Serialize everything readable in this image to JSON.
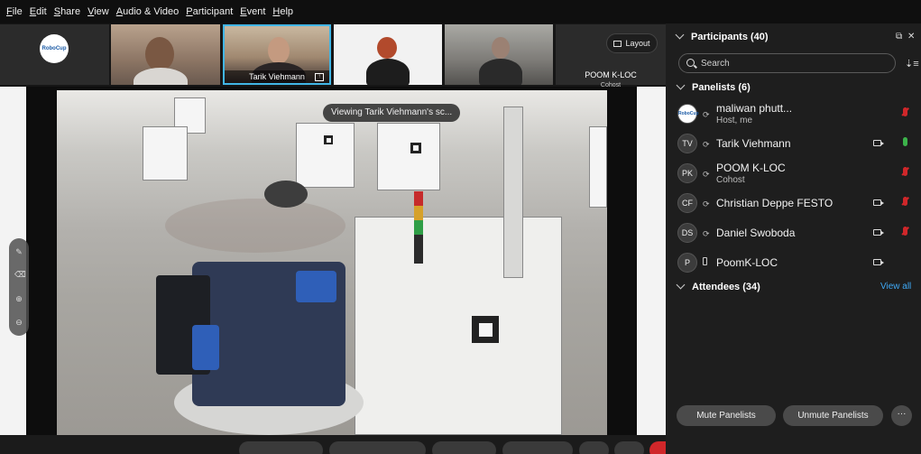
{
  "menu": {
    "items": [
      {
        "u": "F",
        "rest": "ile"
      },
      {
        "u": "E",
        "rest": "dit"
      },
      {
        "u": "S",
        "rest": "hare"
      },
      {
        "u": "V",
        "rest": "iew"
      },
      {
        "u": "A",
        "rest": "udio & Video"
      },
      {
        "u": "P",
        "rest": "articipant"
      },
      {
        "u": "E",
        "rest": "vent"
      },
      {
        "u": "H",
        "rest": "elp"
      }
    ]
  },
  "thumbnails": {
    "logo_text": "RoboCup",
    "active_name": "Tarik Viehmann",
    "poom_name": "POOM K-LOC",
    "poom_role": "Cohost",
    "layout_label": "Layout"
  },
  "stage": {
    "viewing_banner": "Viewing Tarik Viehmann's sc..."
  },
  "panel": {
    "title": "Participants (40)",
    "search_placeholder": "Search",
    "panelists_label": "Panelists (6)",
    "attendees_label": "Attendees (34)",
    "view_all": "View all",
    "panelists": [
      {
        "initials": "",
        "name": "maliwan phutt...",
        "role": "Host, me",
        "mic": "muted",
        "camera": false
      },
      {
        "initials": "TV",
        "name": "Tarik Viehmann",
        "role": "",
        "mic": "on",
        "camera": true
      },
      {
        "initials": "PK",
        "name": "POOM K-LOC",
        "role": "Cohost",
        "mic": "muted",
        "camera": false
      },
      {
        "initials": "CF",
        "name": "Christian Deppe FESTO",
        "role": "",
        "mic": "muted",
        "camera": true
      },
      {
        "initials": "DS",
        "name": "Daniel Swoboda",
        "role": "",
        "mic": "muted",
        "camera": true
      },
      {
        "initials": "P",
        "name": "PoomK-LOC",
        "role": "",
        "mic": "none",
        "camera": true
      }
    ],
    "mute_button": "Mute Panelists",
    "unmute_button": "Unmute Panelists",
    "more_label": "···"
  },
  "colors": {
    "accent": "#41b6e6",
    "link": "#3fa9f5",
    "muted_mic": "#d0272a",
    "active_mic": "#3cb34a"
  }
}
